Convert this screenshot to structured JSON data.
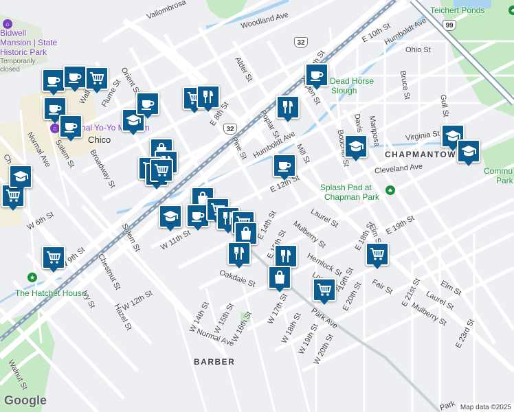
{
  "map": {
    "attribution": "Map data ©2025",
    "logo": "Google",
    "colors": {
      "marker": "#0d5c8f",
      "park": "#c5e8c5",
      "water": "#a9d3f0",
      "road": "#ffffff",
      "rail": "#8aa0b5",
      "background": "#eeeff2"
    }
  },
  "areas": [
    "CHAPMANTOWN",
    "BARBER"
  ],
  "places": {
    "teichert": "Teichert Ponds",
    "splash": "Splash Pad at",
    "splash2": "Chapman Park",
    "hatchet": "The Hatchet House",
    "deadhorse": "Dead Horse",
    "deadhorse2": "Slough",
    "bidwell": "Bidwell",
    "bidwell2": "Mansion | State",
    "bidwell3": "Historic Park",
    "bidwell4": "Temporarily",
    "bidwell5": "closed",
    "museum": "National Yo-Yo Museum",
    "chico": "Chico",
    "commu": "Commu",
    "commu2": "Park"
  },
  "streets": {
    "vallombrosa": "Vallombrosa",
    "woodland": "Woodland Ave",
    "e10th": "E 10th St",
    "humboldt_e": "Humboldt Ave",
    "ohio": "Ohio St",
    "e8th": "E 8th St",
    "eighth": "E 8th St",
    "alder": "Alder St",
    "aspen": "Aspen St",
    "orient": "Orient St",
    "wall": "Wall St",
    "flume": "Flume St",
    "poplar": "Poplar St",
    "humboldt": "Humboldt Ave",
    "mill": "Mill St",
    "pine": "Pine St",
    "bruce": "Bruce St",
    "gull": "Gull St",
    "virginia": "Virginia St",
    "boucher": "Boucher St",
    "davis": "Davis St",
    "mariposa": "Mariposa",
    "cleveland": "Cleveland Ave",
    "e12th": "E 12th St",
    "normal": "Normal Ave",
    "salem": "Salem St",
    "broadway": "Broadway St",
    "w6th": "W 6th St",
    "w9th": "W 9th St",
    "salem2": "Salem St",
    "chestnut": "Chestnut St",
    "w11th": "W 11th St",
    "w12th": "W 12th St",
    "ivy": "Ivy St",
    "hazel": "Hazel St",
    "oakdale": "Oakdale St",
    "w14th": "W 14th St",
    "w15th": "W 15th St",
    "w16th": "W 16th St",
    "w17th": "W 17th St",
    "w18th": "W 18th St",
    "w19th": "W 19th St",
    "w20th": "W 20th St",
    "normal2": "Normal Ave",
    "walnut": "Walnut St",
    "laurel": "Laurel St",
    "mulberry": "Mulberry St",
    "hemlock": "Hemlock St",
    "locust": "Locust St",
    "e15th": "E 15th St",
    "e14th": "E 14th St",
    "e18th": "E 18th St",
    "e19th": "E 19th St",
    "e20th": "E 20th St",
    "e21st": "E 21st St",
    "e23rd": "E 23rd St",
    "elm": "Elm St",
    "elm2": "Elm St",
    "fair": "Fair St",
    "laurel2": "Laurel St",
    "mulberry2": "Mulberry St",
    "park": "Park Ave",
    "park2": "Park",
    "e19th_far": "19th St",
    "chest": "Ch"
  },
  "highways": {
    "h32a": "32",
    "h32b": "32",
    "h99": "99"
  },
  "markers": [
    {
      "type": "cafe-icon"
    },
    {
      "type": "cafe-icon"
    },
    {
      "type": "shopping-cart-icon"
    },
    {
      "type": "cafe-icon"
    },
    {
      "type": "cafe-icon"
    },
    {
      "type": "graduation-cap-icon"
    },
    {
      "type": "cafe-icon"
    },
    {
      "type": "shopping-cart-icon"
    },
    {
      "type": "restaurant-icon"
    },
    {
      "type": "cafe-icon"
    },
    {
      "type": "restaurant-icon"
    },
    {
      "type": "graduation-cap-icon"
    },
    {
      "type": "cafe-icon"
    },
    {
      "type": "graduation-cap-icon"
    },
    {
      "type": "graduation-cap-icon"
    },
    {
      "type": "shopping-bag-icon"
    },
    {
      "type": "restaurant-icon"
    },
    {
      "type": "shopping-cart-icon"
    },
    {
      "type": "shopping-cart-icon"
    },
    {
      "type": "shopping-cart-icon"
    },
    {
      "type": "graduation-cap-icon"
    },
    {
      "type": "shopping-cart-icon"
    },
    {
      "type": "shopping-bag-icon"
    },
    {
      "type": "graduation-cap-icon"
    },
    {
      "type": "cafe-icon"
    },
    {
      "type": "shopping-cart-icon"
    },
    {
      "type": "restaurant-icon"
    },
    {
      "type": "shopping-cart-icon"
    },
    {
      "type": "shopping-bag-icon"
    },
    {
      "type": "restaurant-icon"
    },
    {
      "type": "restaurant-icon"
    },
    {
      "type": "shopping-bag-icon"
    },
    {
      "type": "shopping-cart-icon"
    },
    {
      "type": "shopping-cart-icon"
    },
    {
      "type": "shopping-cart-icon"
    }
  ]
}
